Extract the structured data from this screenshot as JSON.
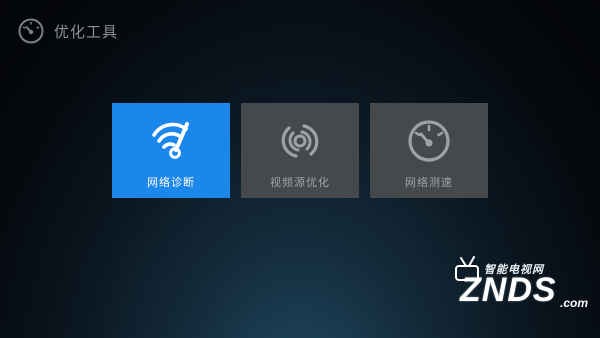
{
  "header": {
    "title": "优化工具",
    "icon": "speedometer-icon"
  },
  "tiles": [
    {
      "label": "网络诊断",
      "icon": "wifi-gauge-icon",
      "selected": true
    },
    {
      "label": "视频源优化",
      "icon": "video-source-icon",
      "selected": false
    },
    {
      "label": "网络测速",
      "icon": "speedometer-icon",
      "selected": false
    }
  ],
  "watermark": {
    "logo": "ZNDS",
    "suffix": ".com",
    "tagline": "智能电视网"
  },
  "colors": {
    "selected_tile": "#1c87ea",
    "tile": "#46494c",
    "header_text": "#8a9095"
  }
}
